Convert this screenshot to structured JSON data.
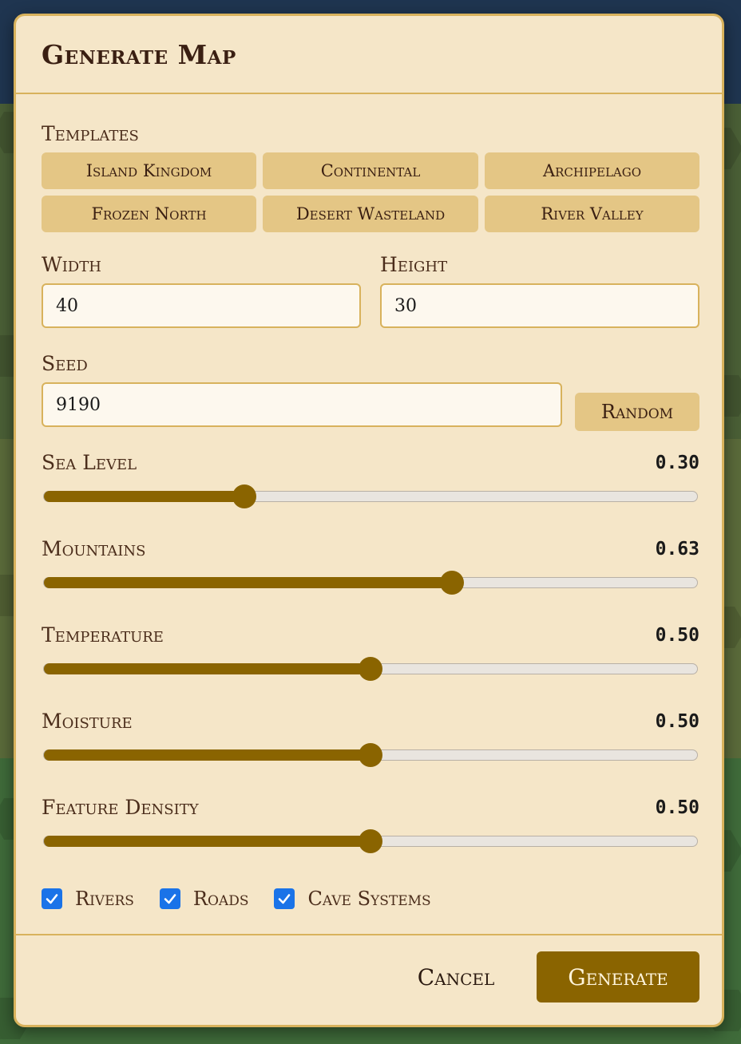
{
  "dialog": {
    "title": "Generate Map"
  },
  "templates": {
    "label": "Templates",
    "items": [
      "Island Kingdom",
      "Continental",
      "Archipelago",
      "Frozen North",
      "Desert Wasteland",
      "River Valley"
    ]
  },
  "width": {
    "label": "Width",
    "value": "40"
  },
  "height": {
    "label": "Height",
    "value": "30"
  },
  "seed": {
    "label": "Seed",
    "value": "9190",
    "random_label": "Random"
  },
  "sliders": [
    {
      "label": "Sea Level",
      "display": "0.30",
      "value": 0.3
    },
    {
      "label": "Mountains",
      "display": "0.63",
      "value": 0.63
    },
    {
      "label": "Temperature",
      "display": "0.50",
      "value": 0.5
    },
    {
      "label": "Moisture",
      "display": "0.50",
      "value": 0.5
    },
    {
      "label": "Feature Density",
      "display": "0.50",
      "value": 0.5
    }
  ],
  "options": [
    {
      "label": "Rivers",
      "checked": true
    },
    {
      "label": "Roads",
      "checked": true
    },
    {
      "label": "Cave Systems",
      "checked": true
    }
  ],
  "footer": {
    "cancel_label": "Cancel",
    "generate_label": "Generate"
  },
  "colors": {
    "accent": "#8a6400",
    "panel": "#f5e6c8",
    "border": "#d8b25c",
    "checkbox": "#1a73e8"
  }
}
